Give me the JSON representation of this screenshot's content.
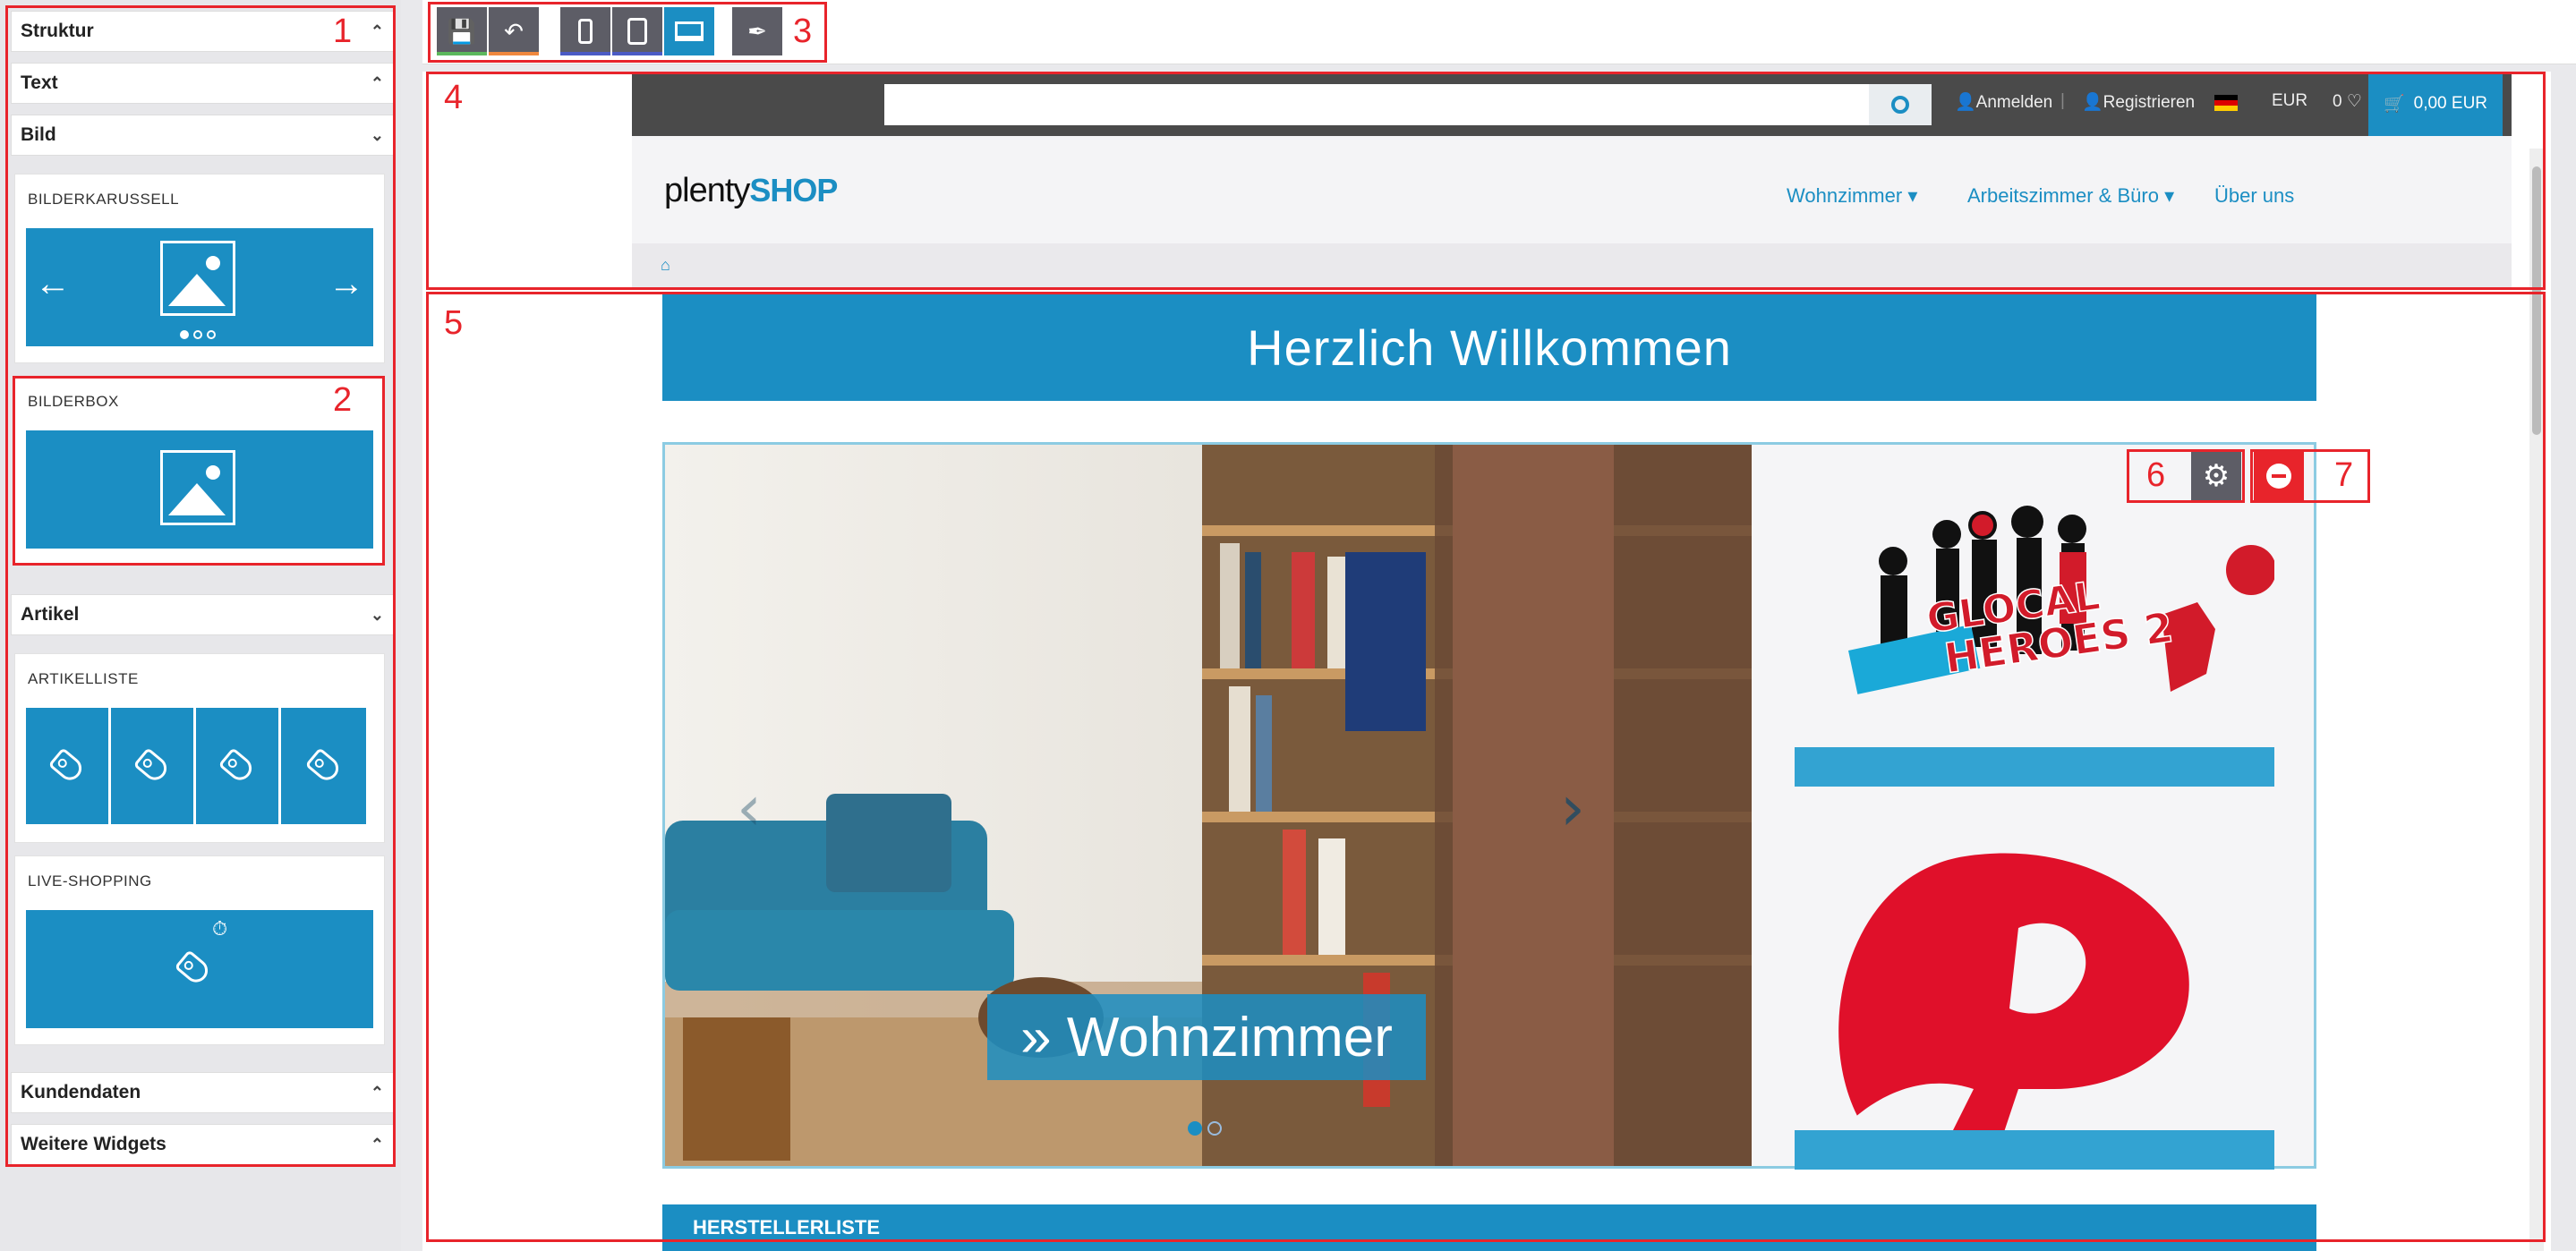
{
  "left_panel": {
    "sections": {
      "struktur": "Struktur",
      "text": "Text",
      "bild": "Bild",
      "artikel": "Artikel",
      "kundendaten": "Kundendaten",
      "weitere": "Weitere Widgets"
    },
    "widgets": {
      "bilderkarussell": "BILDERKARUSSELL",
      "bilderbox": "BILDERBOX",
      "artikelliste": "ARTIKELLISTE",
      "live_shopping": "LIVE-SHOPPING"
    },
    "icons": {
      "collapse": "chevron-up-icon",
      "expand": "chevron-down-icon"
    }
  },
  "toolbar": {
    "buttons": [
      "save-icon",
      "undo-icon",
      "mobile-icon",
      "tablet-icon",
      "desktop-icon",
      "feather-icon"
    ],
    "stripe_colors": {
      "save": "#5cb85c",
      "undo": "#f0883e",
      "mobile": "#4b5bc5",
      "tablet": "#4b5bc5",
      "desktop": "#1b8ec3",
      "desktop_bg": "#1b8ec3"
    }
  },
  "shop": {
    "search_placeholder": "",
    "login": "Anmelden",
    "register": "Registrieren",
    "currency": "EUR",
    "wishlist_count": "0",
    "cart": "0,00 EUR",
    "logo_plenty": "plenty",
    "logo_shop": "SHOP",
    "nav": [
      "Wohnzimmer",
      "Arbeitszimmer & Büro",
      "Über uns"
    ],
    "welcome": "Herzlich Willkommen",
    "slide_caption": "» Wohnzimmer",
    "hersteller": "HERSTELLERLISTE",
    "accent": "#1b8ec3",
    "brand_red": "#e0102a"
  },
  "annotations": [
    "1",
    "2",
    "3",
    "4",
    "5",
    "6",
    "7"
  ],
  "annotation_color": "#e8242b"
}
